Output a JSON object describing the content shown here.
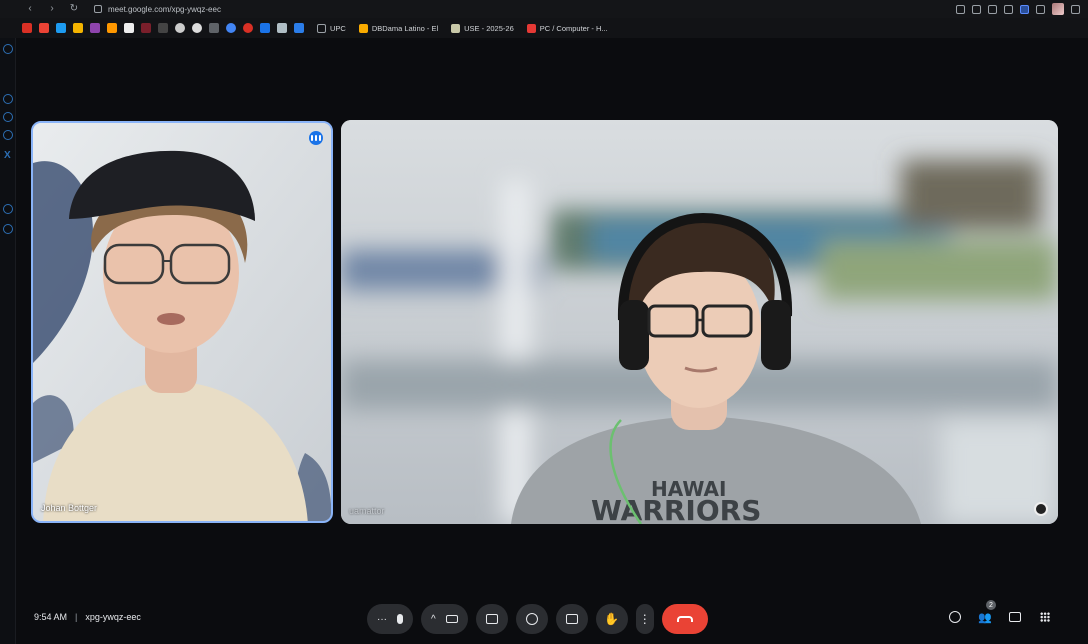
{
  "browser": {
    "url": "meet.google.com/xpg-ywqz-eec",
    "bookmarks": [
      {
        "label": "UPC"
      },
      {
        "label": "DBDama Latino - El"
      },
      {
        "label": "USE - 2025-26"
      },
      {
        "label": "PC / Computer - H..."
      }
    ]
  },
  "meeting": {
    "time": "9:54 AM",
    "code": "xpg-ywqz-eec",
    "participant_count": "2"
  },
  "participants": [
    {
      "name": "Johan Bottger",
      "speaking": true
    },
    {
      "name": "uamattor",
      "speaking": false
    }
  ],
  "colors": {
    "accent": "#8ab4f8",
    "end_call": "#ea4335",
    "background": "#0b0c0f"
  }
}
